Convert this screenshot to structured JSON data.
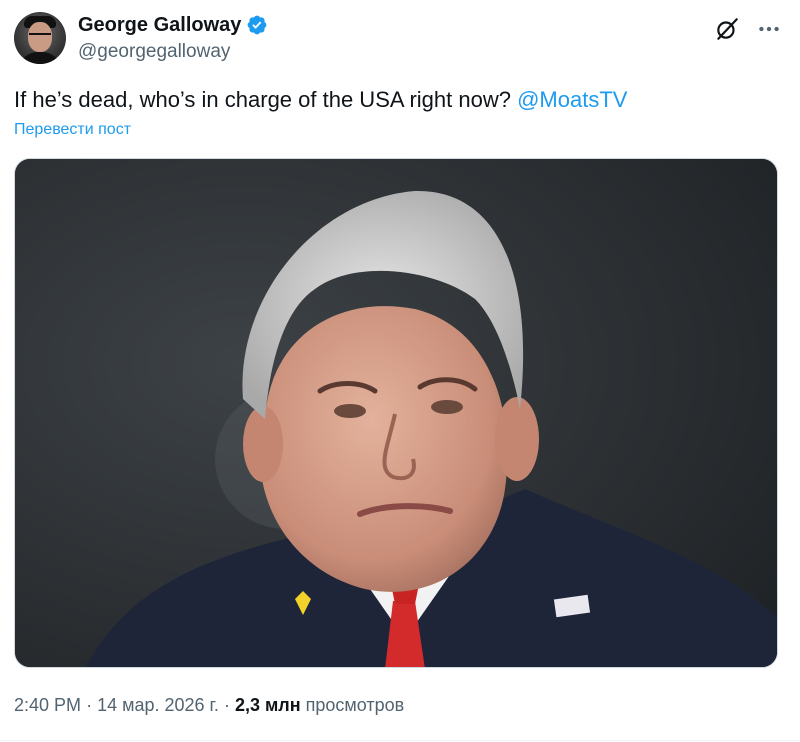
{
  "author": {
    "display_name": "George Galloway",
    "handle": "@georgegalloway",
    "verified": true
  },
  "icons": {
    "verified": "verified-badge-icon",
    "grok": "grok-icon",
    "more": "more-icon"
  },
  "tweet": {
    "text": "If he’s dead, who’s in charge of the USA right now?",
    "mention": "@MoatsTV",
    "translate_label": "Перевести пост"
  },
  "meta": {
    "time": "2:40 PM",
    "separator1": "·",
    "date": "14 мар. 2026 г.",
    "separator2": "·",
    "views_count": "2,3 млн",
    "views_label": "просмотров"
  },
  "colors": {
    "accent": "#1d9bf0",
    "text": "#0f1419",
    "secondary": "#536471"
  }
}
